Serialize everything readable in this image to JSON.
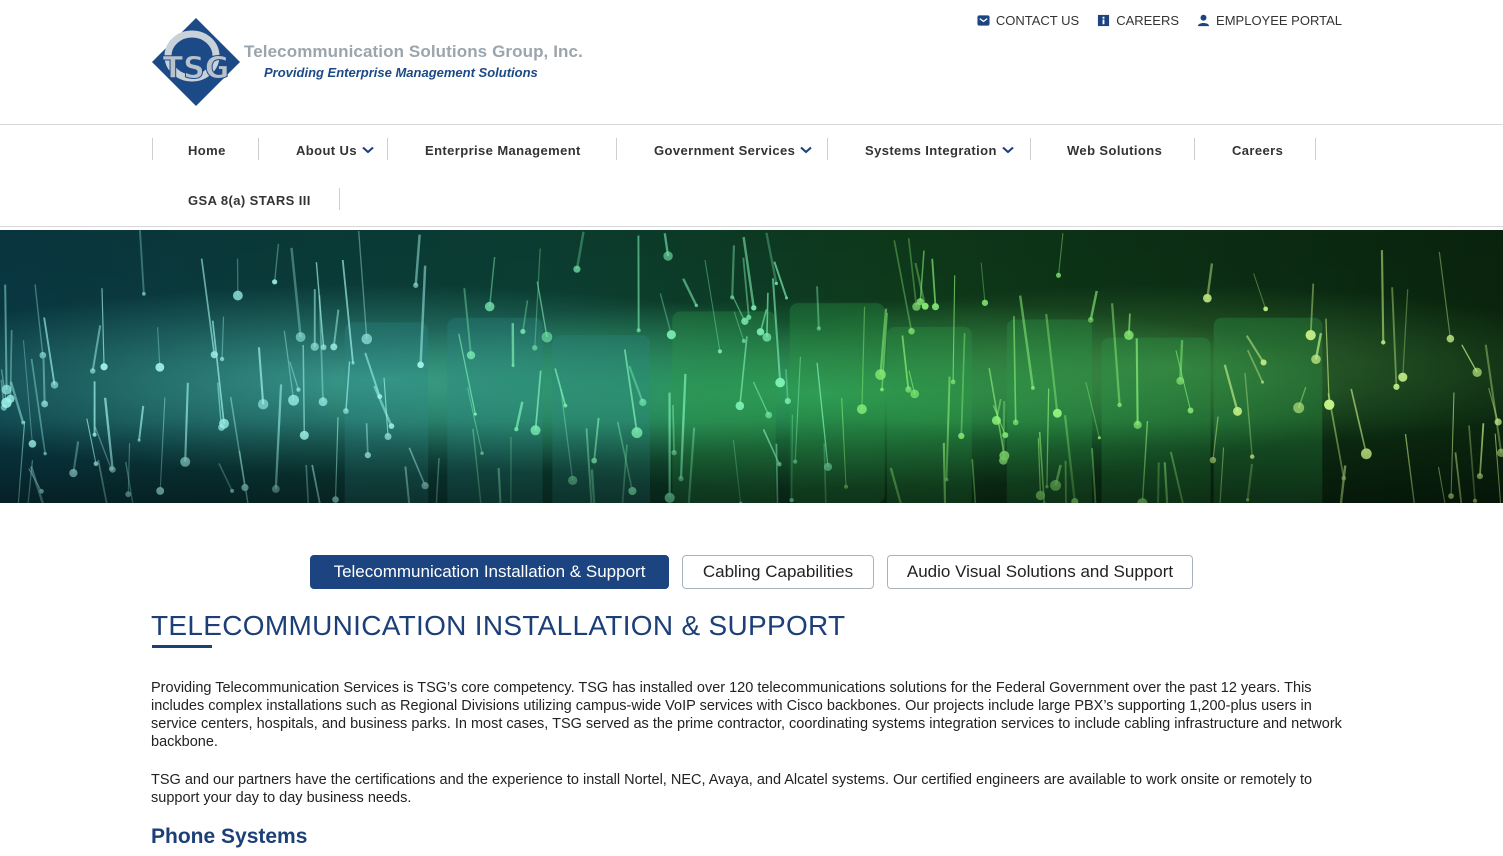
{
  "header": {
    "company_name": "Telecommunication Solutions Group, Inc.",
    "tagline": "Providing Enterprise Management Solutions",
    "logo_letters": "TSG"
  },
  "utility_links": [
    {
      "label": "CONTACT US",
      "icon": "envelope-icon"
    },
    {
      "label": "CAREERS",
      "icon": "briefcase-icon"
    },
    {
      "label": "EMPLOYEE PORTAL",
      "icon": "user-icon"
    }
  ],
  "nav": {
    "items": [
      {
        "label": "Home",
        "has_dropdown": false
      },
      {
        "label": "About Us",
        "has_dropdown": true
      },
      {
        "label": "Enterprise Management",
        "has_dropdown": false
      },
      {
        "label": "Government Services",
        "has_dropdown": true
      },
      {
        "label": "Systems Integration",
        "has_dropdown": true
      },
      {
        "label": "Web Solutions",
        "has_dropdown": false
      },
      {
        "label": "Careers",
        "has_dropdown": false
      },
      {
        "label": "GSA 8(a) STARS III",
        "has_dropdown": false
      }
    ]
  },
  "tabs": [
    {
      "label": "Telecommunication Installation & Support",
      "active": true
    },
    {
      "label": "Cabling Capabilities",
      "active": false
    },
    {
      "label": "Audio Visual Solutions and Support",
      "active": false
    }
  ],
  "content": {
    "title": "TELECOMMUNICATION INSTALLATION & SUPPORT",
    "paragraph_1": "Providing Telecommunication Services is TSG’s core competency. TSG has installed over 120 telecommunications solutions for the Federal Government over the past 12 years.  This includes complex installations such as Regional Divisions utilizing campus-wide VoIP services with Cisco backbones.  Our projects include large PBX’s supporting 1,200-plus users in service centers, hospitals, and business parks.  In most cases, TSG served as the prime contractor, coordinating systems integration services to include cabling infrastructure and network backbone.",
    "paragraph_2": "TSG and our partners have the certifications and the experience to install Nortel, NEC, Avaya, and Alcatel systems. Our certified engineers are available to work onsite or remotely to support your day to day business needs.",
    "section_heading": "Phone Systems"
  },
  "colors": {
    "brand_navy": "#1c4480",
    "heading_navy": "#1c3f78",
    "logo_grey": "#9aa5ad"
  }
}
